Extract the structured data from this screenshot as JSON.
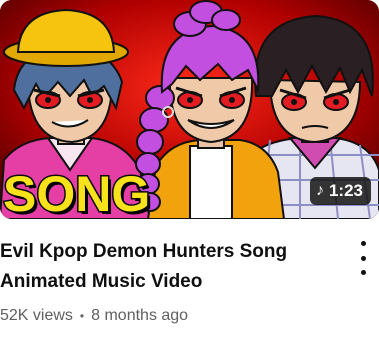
{
  "thumbnail": {
    "overlay_text": "SONG",
    "duration": "1:23",
    "duration_icon": "music-note-icon",
    "colors": {
      "background": "#b00000",
      "song_text": "#f7e21b",
      "hair_left": "#4f6f9e",
      "hat": "#f6c30e",
      "hair_center": "#c24fe0",
      "hair_right": "#2a1f23",
      "eyes": "#e31b23"
    }
  },
  "video": {
    "title_line1": "Evil Kpop Demon Hunters Song",
    "title_line2": "Animated Music Video",
    "views": "52K views",
    "separator": "•",
    "age": "8 months ago"
  },
  "actions": {
    "menu_icon": "more-vertical-icon"
  }
}
